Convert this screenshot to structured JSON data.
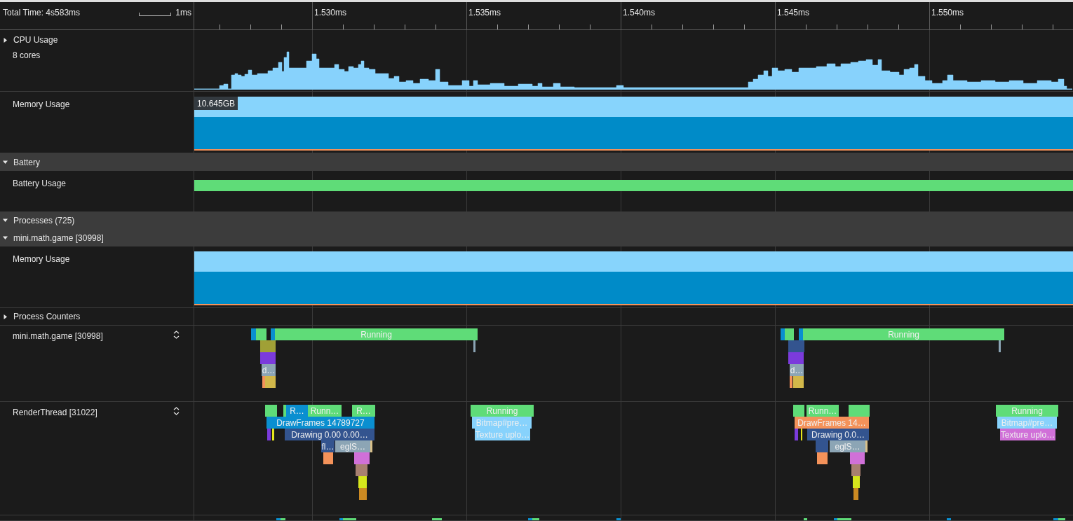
{
  "ruler": {
    "total_time": "Total Time: 4s583ms",
    "scale_label": "1ms",
    "ticks": [
      "1.530ms",
      "1.535ms",
      "1.540ms",
      "1.545ms",
      "1.550ms"
    ]
  },
  "tracks": [
    {
      "kind": "cpu",
      "label": "CPU Usage",
      "sublabel": "8 cores",
      "expanded": false
    },
    {
      "kind": "memory",
      "label": "Memory Usage",
      "value_label": "10.645GB"
    },
    {
      "kind": "group",
      "label": "Battery",
      "expanded": true
    },
    {
      "kind": "battery",
      "label": "Battery Usage"
    },
    {
      "kind": "group",
      "label": "Processes (725)",
      "expanded": true
    },
    {
      "kind": "group",
      "label": "mini.math.game [30998]",
      "expanded": true
    },
    {
      "kind": "memory",
      "label": "Memory Usage"
    },
    {
      "kind": "counters",
      "label": "Process Counters",
      "expanded": false
    },
    {
      "kind": "thread",
      "label": "mini.math.game [30998]",
      "slices": [
        {
          "color": "#0a8fd0"
        },
        {
          "color": "#5fdc78"
        },
        {
          "color": "#0a8fd0"
        },
        {
          "label": "Running",
          "color": "#5fdc78"
        },
        {
          "color": "#a0a036"
        },
        {
          "color": "#7b3bdc"
        },
        {
          "label": "d…",
          "color": "#8ca5b5"
        },
        {
          "color": "#f4925a"
        },
        {
          "color": "#d2b84a"
        },
        {
          "color": "#8ca5b5"
        },
        {
          "color": "#0a8fd0"
        },
        {
          "color": "#5fdc78"
        },
        {
          "color": "#0a8fd0"
        },
        {
          "label": "Running",
          "color": "#5fdc78"
        },
        {
          "color": "#33548f"
        },
        {
          "color": "#7b3bdc"
        },
        {
          "label": "d…",
          "color": "#8ca5b5"
        },
        {
          "color": "#f4925a"
        },
        {
          "color": "#d2b84a"
        },
        {
          "color": "#8ca5b5"
        }
      ]
    },
    {
      "kind": "thread",
      "label": "RenderThread [31022]",
      "slices": [
        {
          "color": "#5fdc78"
        },
        {
          "color": "#5fdc78"
        },
        {
          "label": "R…",
          "color": "#0a8fd0"
        },
        {
          "label": "Runn…",
          "color": "#5fdc78"
        },
        {
          "label": "R…",
          "color": "#5fdc78"
        },
        {
          "label": "DrawFrames 14789727",
          "color": "#0a8fd0"
        },
        {
          "color": "#7b3bdc"
        },
        {
          "color": "#e6e61c"
        },
        {
          "label": "Drawing 0.00 0.00…",
          "color": "#33548f"
        },
        {
          "label": "fl…",
          "color": "#33548f"
        },
        {
          "label": "eglS…",
          "color": "#8ca5b5"
        },
        {
          "color": "#d8c08a"
        },
        {
          "color": "#f4925a"
        },
        {
          "color": "#d070d8"
        },
        {
          "color": "#a88070"
        },
        {
          "color": "#d6e61c"
        },
        {
          "color": "#cc8a22"
        },
        {
          "label": "Running",
          "color": "#5fdc78"
        },
        {
          "label": "Bitmap#pre…",
          "color": "#87d2fc"
        },
        {
          "label": "Texture uplo…",
          "color": "#87d2fc"
        },
        {
          "color": "#5fdc78"
        },
        {
          "label": "Runn…",
          "color": "#5fdc78"
        },
        {
          "color": "#5fdc78"
        },
        {
          "label": "DrawFrames 14…",
          "color": "#f4925a"
        },
        {
          "color": "#7b3bdc"
        },
        {
          "color": "#e6e61c"
        },
        {
          "label": "Drawing 0.0…",
          "color": "#33548f"
        },
        {
          "color": "#33548f"
        },
        {
          "label": "eglS…",
          "color": "#8ca5b5"
        },
        {
          "color": "#d8c08a"
        },
        {
          "color": "#f4925a"
        },
        {
          "color": "#d070d8"
        },
        {
          "color": "#a88070"
        },
        {
          "color": "#d6e61c"
        },
        {
          "color": "#cc8a22"
        },
        {
          "label": "Running",
          "color": "#5fdc78"
        },
        {
          "label": "Bitmap#pre…",
          "color": "#87d2fc"
        },
        {
          "label": "Texture uplo…",
          "color": "#d070d8"
        }
      ]
    },
    {
      "kind": "thread",
      "slices": [
        {
          "color": "#0a8fd0"
        },
        {
          "color": "#5fdc78"
        },
        {
          "color": "#0a8fd0"
        },
        {
          "color": "#5fdc78"
        },
        {
          "color": "#5fdc78"
        },
        {
          "color": "#0a8fd0"
        },
        {
          "color": "#5fdc78"
        },
        {
          "color": "#0a8fd0"
        },
        {
          "color": "#5fdc78"
        },
        {
          "color": "#0a8fd0"
        },
        {
          "color": "#5fdc78"
        },
        {
          "color": "#0a8fd0"
        },
        {
          "color": "#0a8fd0"
        },
        {
          "color": "#5fdc78"
        }
      ]
    }
  ]
}
